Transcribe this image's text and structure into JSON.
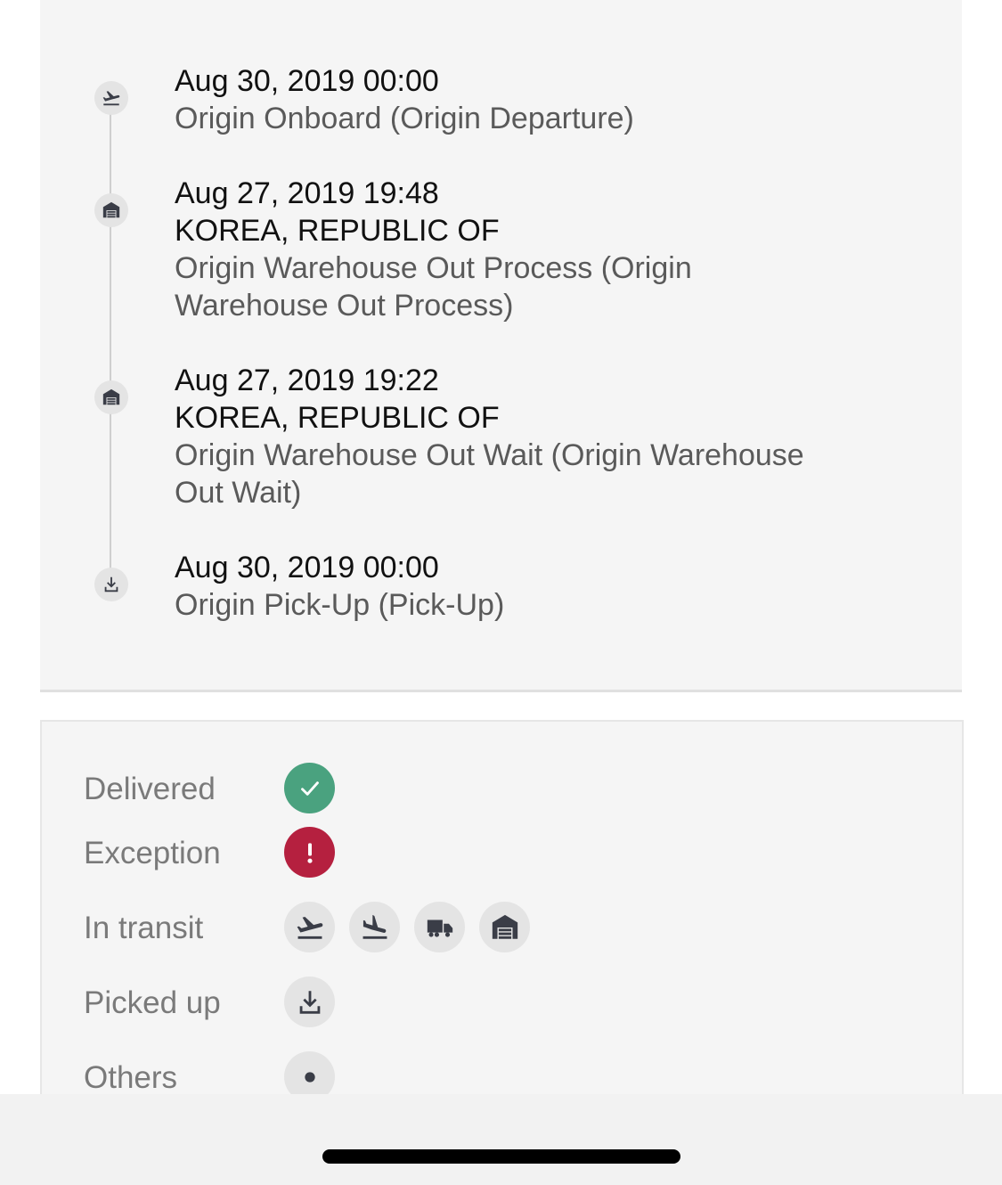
{
  "timeline": [
    {
      "date": "Aug 30, 2019 00:00",
      "location": "",
      "description": "Origin Onboard (Origin Departure)",
      "icon": "plane-departure-icon"
    },
    {
      "date": "Aug 27, 2019 19:48",
      "location": "KOREA, REPUBLIC OF",
      "description_lines": [
        "Origin Warehouse Out Process (Origin",
        "Warehouse Out Process)"
      ],
      "icon": "warehouse-icon"
    },
    {
      "date": "Aug 27, 2019 19:22",
      "location": "KOREA, REPUBLIC OF",
      "description_lines": [
        "Origin Warehouse Out Wait (Origin Warehouse",
        "Out Wait)"
      ],
      "icon": "warehouse-icon"
    },
    {
      "date": "Aug 30, 2019 00:00",
      "location": "",
      "description": "Origin Pick-Up (Pick-Up)",
      "icon": "pickup-download-icon"
    }
  ],
  "legend": {
    "delivered": {
      "label": "Delivered",
      "icon": "checkmark-icon",
      "color": "#4aa27f"
    },
    "exception": {
      "label": "Exception",
      "icon": "exclamation-icon",
      "color": "#b5203f"
    },
    "in_transit": {
      "label": "In transit",
      "icons": [
        "plane-departure-icon",
        "plane-arrival-icon",
        "truck-icon",
        "warehouse-icon"
      ]
    },
    "picked_up": {
      "label": "Picked up",
      "icon": "pickup-download-icon"
    },
    "others": {
      "label": "Others",
      "icon": "dot-icon"
    }
  },
  "colors": {
    "icon": "#3a3d47",
    "panel": "#f5f5f5",
    "line": "#cfcfcf"
  }
}
